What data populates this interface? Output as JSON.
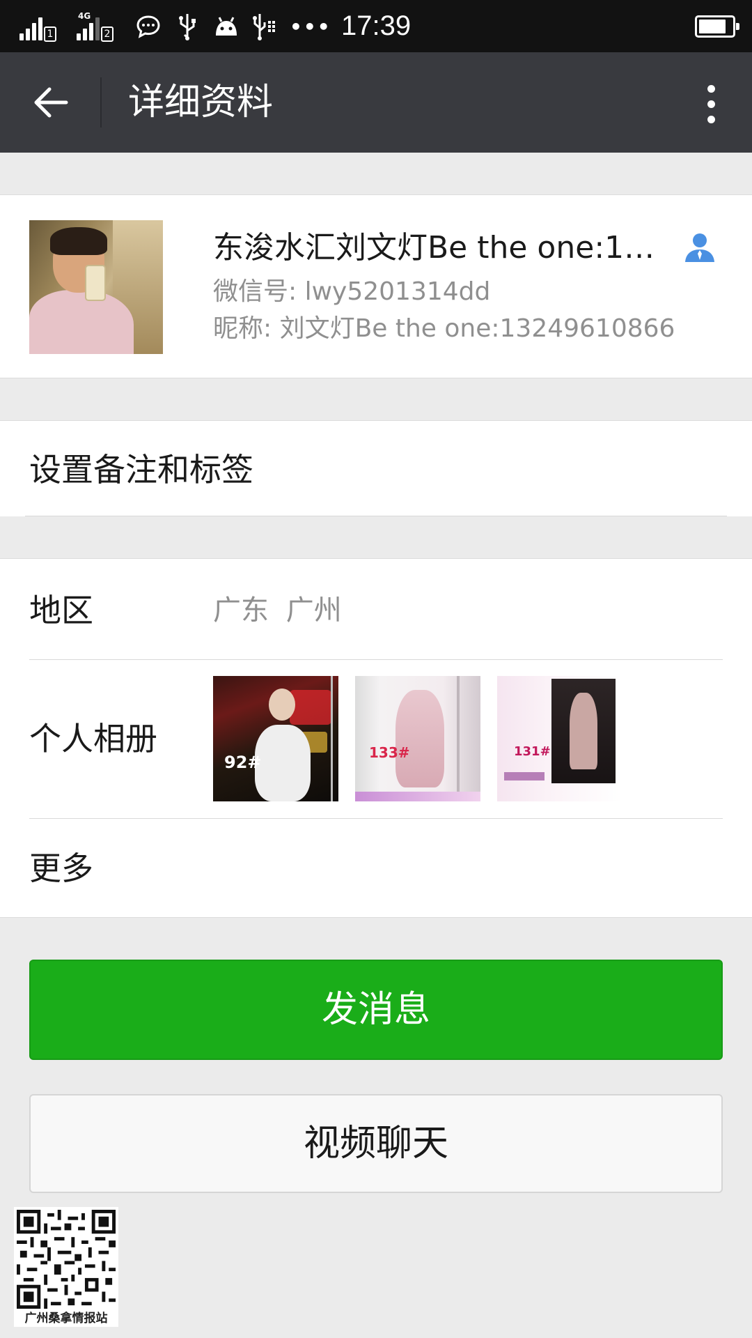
{
  "status_bar": {
    "time": "17:39",
    "sim1": "1",
    "sim2": "2",
    "network_type": "4G",
    "more_dots": "•••",
    "battery_level": 0.85,
    "icons": [
      "signal-icon",
      "signal-icon",
      "message-icon",
      "usb-icon",
      "android-icon",
      "usb-debug-icon"
    ]
  },
  "header": {
    "title": "详细资料",
    "back_icon": "arrow-left-icon",
    "more_icon": "more-vertical-icon"
  },
  "profile": {
    "display_name": "东浚水汇刘文灯Be the one:13249610866",
    "wechat_id": "微信号: lwy5201314dd",
    "nickname": "昵称: 刘文灯Be the one:13249610866",
    "contact_icon": "contact-person-icon",
    "accent_color": "#4a90e2"
  },
  "remark": {
    "label": "设置备注和标签"
  },
  "details": {
    "region_label": "地区",
    "region_value": "广东 广州",
    "album_label": "个人相册",
    "album_tags": [
      "92#",
      "133#",
      "131#"
    ],
    "more_label": "更多"
  },
  "actions": {
    "send_message": "发消息",
    "video_chat": "视频聊天",
    "primary_color": "#1aad19"
  },
  "watermark": {
    "caption": "广州桑拿情报站"
  }
}
